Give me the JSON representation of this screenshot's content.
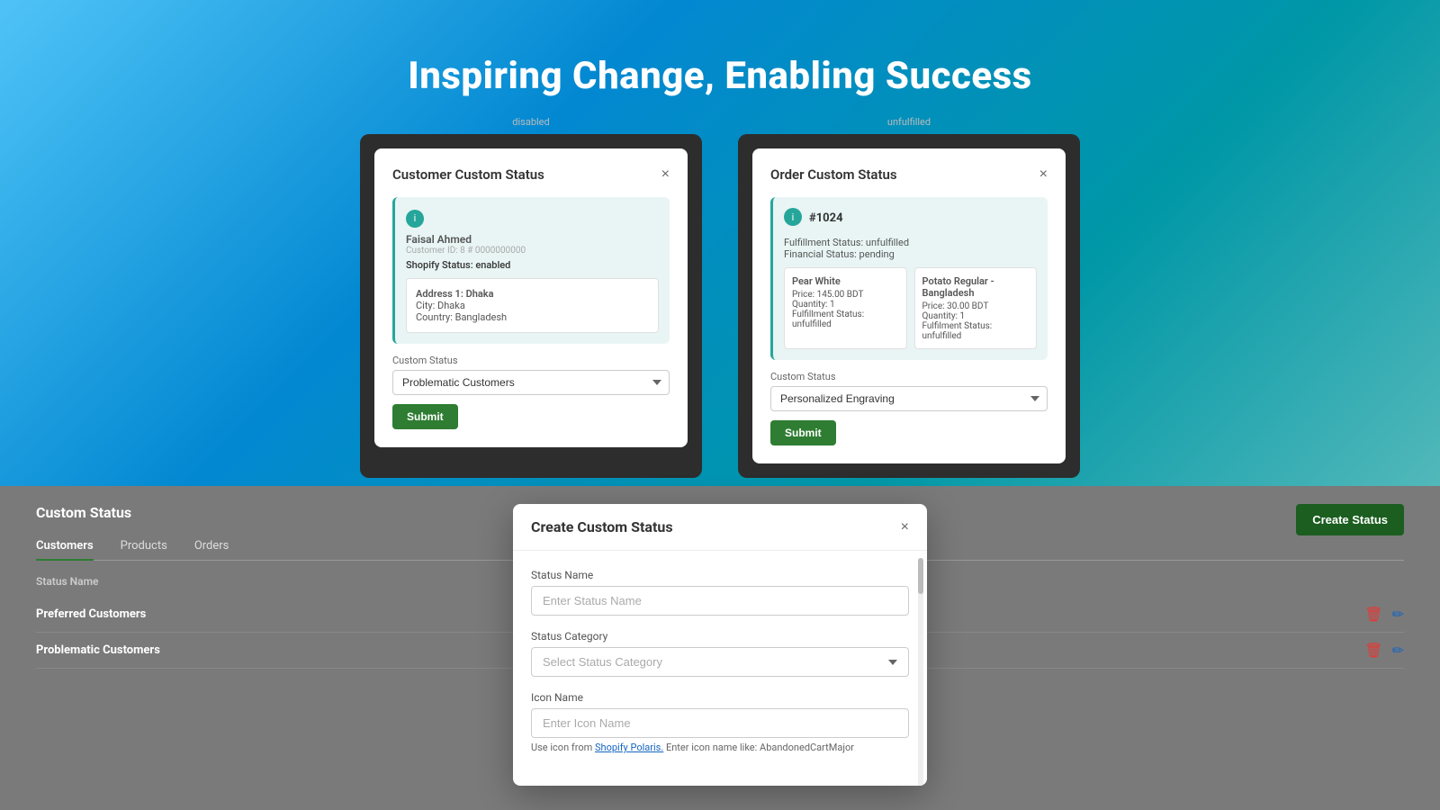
{
  "page": {
    "title": "Inspiring Change, Enabling Success"
  },
  "customer_modal": {
    "title": "Customer Custom Status",
    "bg_label": "disabled",
    "customer_name": "Faisal Ahmed",
    "customer_id": "Customer ID: 8 # 0000000000",
    "shopify_status": "Shopify Status: enabled",
    "address_title": "Address 1: Dhaka",
    "address_city": "City: Dhaka",
    "address_country": "Country: Bangladesh",
    "custom_status_label": "Custom Status",
    "custom_status_value": "Problematic Customers",
    "submit_label": "Submit",
    "close_label": "×"
  },
  "order_modal": {
    "title": "Order Custom Status",
    "bg_label": "unfulfilled",
    "order_number": "#1024",
    "fulfillment_status": "Fulfillment Status: unfulfilled",
    "financial_status": "Financial Status: pending",
    "item1_name": "Pear White",
    "item1_price": "Price: 145.00 BDT",
    "item1_qty": "Quantity: 1",
    "item1_fulfillment": "Fulfillment Status: unfulfilled",
    "item2_name": "Potato Regular - Bangladesh",
    "item2_price": "Price: 30.00 BDT",
    "item2_qty": "Quantity: 1",
    "item2_fulfillment": "Fulfilment Status: unfulfilled",
    "custom_status_label": "Custom Status",
    "custom_status_value": "Personalized Engraving",
    "submit_label": "Submit",
    "close_label": "×"
  },
  "bottom_section": {
    "title": "Custom Status",
    "create_btn_label": "Create Status",
    "tabs": [
      {
        "label": "Customers",
        "active": true
      },
      {
        "label": "Products",
        "active": false
      },
      {
        "label": "Orders",
        "active": false
      }
    ],
    "table_header": "Status Name",
    "rows": [
      {
        "name": "Preferred Customers"
      },
      {
        "name": "Problematic Customers"
      }
    ]
  },
  "create_modal": {
    "title": "Create Custom Status",
    "close_label": "×",
    "status_name_label": "Status Name",
    "status_name_placeholder": "Enter Status Name",
    "status_category_label": "Status Category",
    "status_category_placeholder": "Select Status Category",
    "icon_name_label": "Icon Name",
    "icon_name_placeholder": "Enter Icon Name",
    "icon_hint_prefix": "Use icon from",
    "icon_hint_link_text": "Shopify Polaris.",
    "icon_hint_suffix": " Enter icon name like: AbandonedCartMajor"
  }
}
